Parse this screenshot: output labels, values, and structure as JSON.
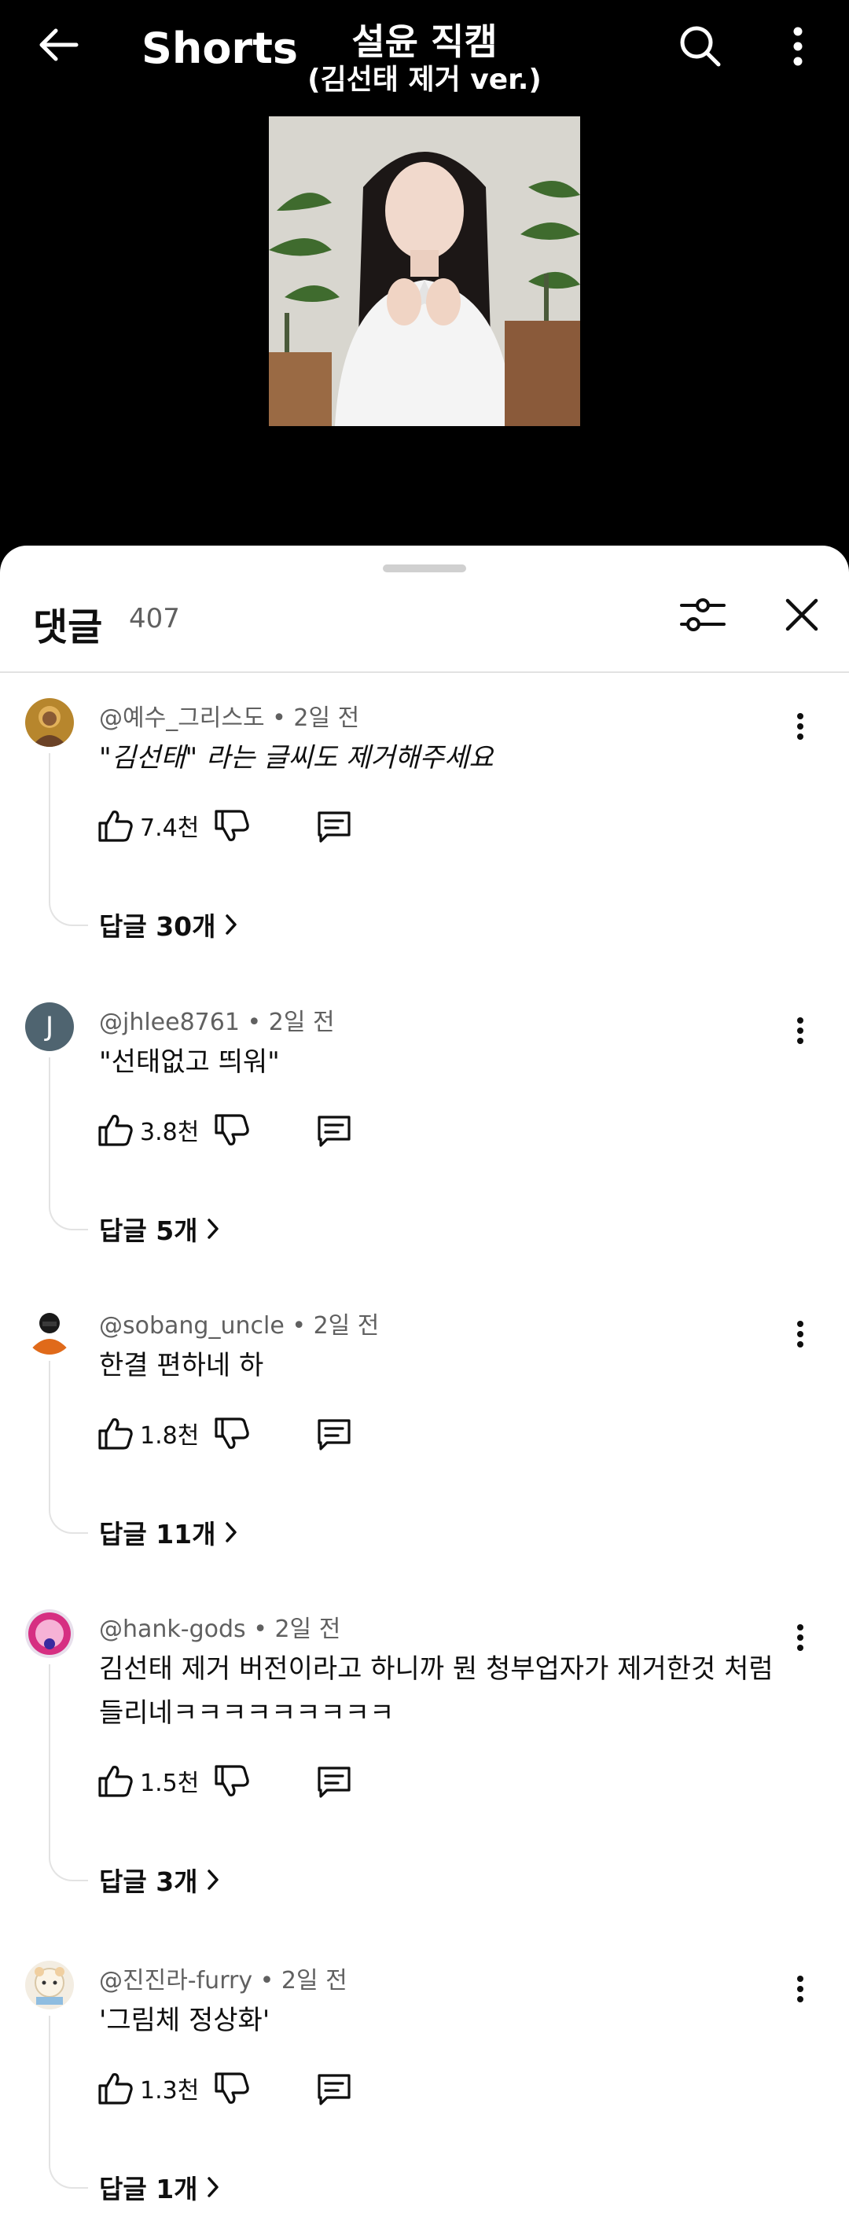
{
  "app": {
    "brand": "Shorts"
  },
  "video": {
    "title_line1": "설윤 직캠",
    "title_line2": "(김선태 제거 ver.)"
  },
  "comments_panel": {
    "title": "댓글",
    "count": "407"
  },
  "comments": [
    {
      "handle": "@예수_그리스도",
      "time": "2일 전",
      "text": "\"김선태\" 라는 글씨도 제거해주세요",
      "likes": "7.4천",
      "replies": "답글 30개"
    },
    {
      "handle": "@jhlee8761",
      "time": "2일 전",
      "text": "\"선태없고 띄워\"",
      "likes": "3.8천",
      "replies": "답글 5개",
      "avatar_letter": "J"
    },
    {
      "handle": "@sobang_uncle",
      "time": "2일 전",
      "text": "한결 편하네 하",
      "likes": "1.8천",
      "replies": "답글 11개"
    },
    {
      "handle": "@hank-gods",
      "time": "2일 전",
      "text": "김선태 제거 버전이라고 하니까 뭔 청부업자가 제거한것 처럼 들리네ㅋㅋㅋㅋㅋㅋㅋㅋㅋ",
      "likes": "1.5천",
      "replies": "답글 3개"
    },
    {
      "handle": "@진진라-furry",
      "time": "2일 전",
      "text": "'그림체 정상화'",
      "likes": "1.3천",
      "replies": "답글 1개"
    }
  ],
  "separator": " • ",
  "colors": {
    "background": "#000000",
    "sheet": "#ffffff",
    "meta_text": "#606060",
    "primary_text": "#0f0f0f"
  }
}
